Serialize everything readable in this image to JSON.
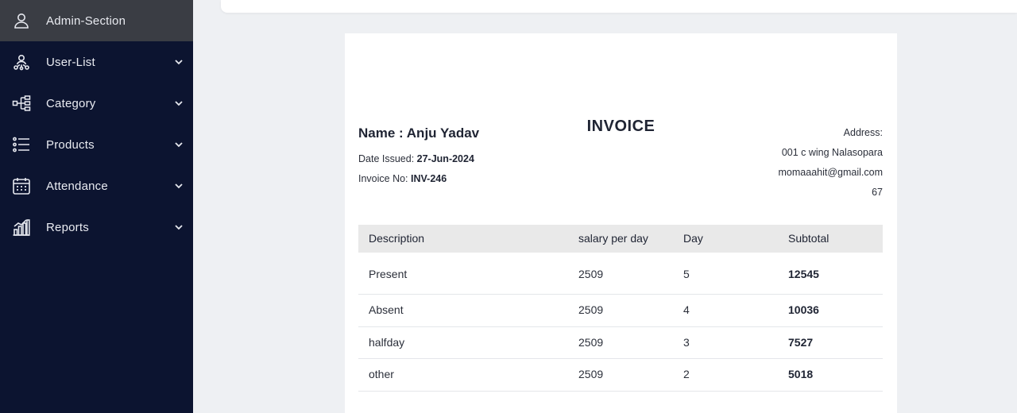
{
  "sidebar": {
    "items": [
      {
        "label": "Admin-Section",
        "icon": "user-icon"
      },
      {
        "label": "User-List",
        "icon": "user-network-icon"
      },
      {
        "label": "Category",
        "icon": "tree-structure-icon"
      },
      {
        "label": "Products",
        "icon": "list-icon"
      },
      {
        "label": "Attendance",
        "icon": "calendar-icon"
      },
      {
        "label": "Reports",
        "icon": "bar-chart-icon"
      }
    ]
  },
  "invoice": {
    "title": "INVOICE",
    "name": "Name : Anju Yadav",
    "date_label": "Date Issued: ",
    "date_value": "27-Jun-2024",
    "invoice_label": "Invoice No: ",
    "invoice_value": "INV-246",
    "address": {
      "label": "Address:",
      "line1": "001 c wing Nalasopara",
      "email": "momaaahit@gmail.com",
      "line3": "67"
    },
    "table": {
      "headers": [
        "Description",
        "salary per day",
        "Day",
        "Subtotal"
      ],
      "rows": [
        [
          "Present",
          "2509",
          "5",
          "12545"
        ],
        [
          "Absent",
          "2509",
          "4",
          "10036"
        ],
        [
          "halfday",
          "2509",
          "3",
          "7527"
        ],
        [
          "other",
          "2509",
          "2",
          "5018"
        ]
      ]
    }
  },
  "colors": {
    "sidebar_bg": "#0c1430",
    "active_item_bg": "#3a3d44",
    "page_bg": "#eef0f3",
    "table_header_bg": "#e9e9e9"
  }
}
